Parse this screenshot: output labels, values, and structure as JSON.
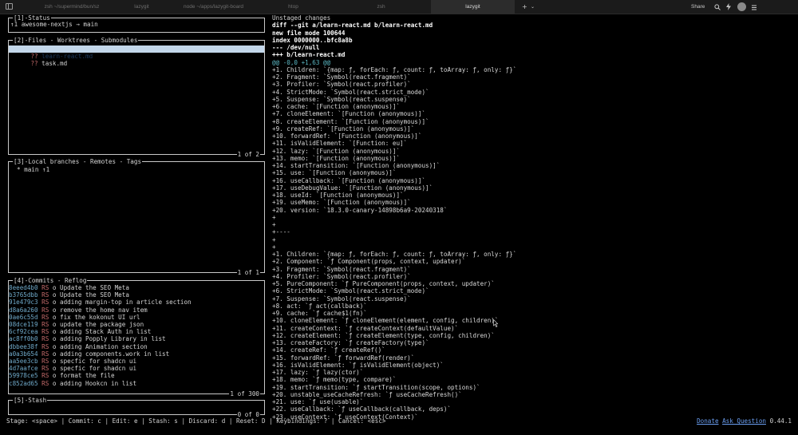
{
  "browser": {
    "tabs": [
      {
        "label": "zsh ~/supermind/bun/sz",
        "active": false
      },
      {
        "label": "lazygit",
        "active": false
      },
      {
        "label": "node ~/apps/lazygit-board",
        "active": false
      },
      {
        "label": "htop",
        "active": false
      },
      {
        "label": "zsh",
        "active": false
      },
      {
        "label": "lazygit",
        "active": true
      }
    ],
    "new_tab": "+",
    "tab_menu": "⌄",
    "share": "Share",
    "icons": [
      "search-icon",
      "bolt-icon",
      "profile-avatar",
      "menu-icon"
    ]
  },
  "status_panel": {
    "title": "[1]-Status",
    "content": "↑1 awesome-nextjs → main"
  },
  "files_panel": {
    "title": "[2]-Files - Worktrees - Submodules",
    "items": [
      {
        "status": "??",
        "name": "learn-react.md",
        "selected": true
      },
      {
        "status": "??",
        "name": "task.md",
        "selected": false
      }
    ],
    "footer": "1 of 2"
  },
  "branches_panel": {
    "title": "[3]-Local branches - Remotes - Tags",
    "items": [
      "* main ↑1"
    ],
    "footer": "1 of 1"
  },
  "commits_panel": {
    "title": "[4]-Commits - Reflog",
    "items": [
      {
        "hash": "8eeed4b0",
        "author": "RS",
        "msg": "Update the SEO Meta"
      },
      {
        "hash": "b3765dbb",
        "author": "RS",
        "msg": "Update the SEO Meta"
      },
      {
        "hash": "91e479c3",
        "author": "RS",
        "msg": "adding margin-top in article section"
      },
      {
        "hash": "d8a6a260",
        "author": "RS",
        "msg": "remove the home nav item"
      },
      {
        "hash": "0ae6c55d",
        "author": "RS",
        "msg": "fix the kokonut UI url"
      },
      {
        "hash": "08dce119",
        "author": "RS",
        "msg": "update the package json"
      },
      {
        "hash": "6cf92cea",
        "author": "RS",
        "msg": "adding Stack Auth in list"
      },
      {
        "hash": "ac8ff0b0",
        "author": "RS",
        "msg": "adding Popply Library in list"
      },
      {
        "hash": "dbbee38f",
        "author": "RS",
        "msg": "adding Animation section"
      },
      {
        "hash": "a0a3b654",
        "author": "RS",
        "msg": "adding components.work in list"
      },
      {
        "hash": "aa5ee3cb",
        "author": "RS",
        "msg": "specfic for shadcn ui"
      },
      {
        "hash": "4d7aafce",
        "author": "RS",
        "msg": "specfic for shadcn ui"
      },
      {
        "hash": "59978ce5",
        "author": "RS",
        "msg": "format the file"
      },
      {
        "hash": "c852ad65",
        "author": "RS",
        "msg": "adding Hookcn in list"
      }
    ],
    "footer": "1 of 300"
  },
  "stash_panel": {
    "title": "[5]-Stash",
    "footer": "0 of 0"
  },
  "diff_panel": {
    "title": "Unstaged changes",
    "header": [
      "diff --git a/learn-react.md b/learn-react.md",
      "new file mode 100644",
      "index 0000000..bfc8a8b",
      "--- /dev/null",
      "+++ b/learn-react.md"
    ],
    "hunk": "@@ -0,0 +1,63 @@",
    "lines": [
      "+1. Children: `{map: ƒ, forEach: ƒ, count: ƒ, toArray: ƒ, only: ƒ}`",
      "+2. Fragment: `Symbol(react.fragment)`",
      "+3. Profiler: `Symbol(react.profiler)`",
      "+4. StrictMode: `Symbol(react.strict_mode)`",
      "+5. Suspense: `Symbol(react.suspense)`",
      "+6. cache: `[Function (anonymous)]`",
      "+7. cloneElement: `[Function (anonymous)]`",
      "+8. createElement: `[Function (anonymous)]`",
      "+9. createRef: `[Function (anonymous)]`",
      "+10. forwardRef: `[Function (anonymous)]`",
      "+11. isValidElement: `[Function: eu]`",
      "+12. lazy: `[Function (anonymous)]`",
      "+13. memo: `[Function (anonymous)]`",
      "+14. startTransition: `[Function (anonymous)]`",
      "+15. use: `[Function (anonymous)]`",
      "+16. useCallback: `[Function (anonymous)]`",
      "+17. useDebugValue: `[Function (anonymous)]`",
      "+18. useId: `[Function (anonymous)]`",
      "+19. useMemo: `[Function (anonymous)]`",
      "+20. version: `18.3.0-canary-14898b6a9-20240318`",
      "+",
      "+",
      "+----",
      "+",
      "+",
      "+1. Children: `{map: ƒ, forEach: ƒ, count: ƒ, toArray: ƒ, only: ƒ}`",
      "+2. Component: `ƒ Component(props, context, updater)`",
      "+3. Fragment: `Symbol(react.fragment)`",
      "+4. Profiler: `Symbol(react.profiler)`",
      "+5. PureComponent: `ƒ PureComponent(props, context, updater)`",
      "+6. StrictMode: `Symbol(react.strict_mode)`",
      "+7. Suspense: `Symbol(react.suspense)`",
      "+8. act: `ƒ act(callback)`",
      "+9. cache: `ƒ cache$1(fn)`",
      "+10. cloneElement: `ƒ cloneElement(element, config, children)`",
      "+11. createContext: `ƒ createContext(defaultValue)`",
      "+12. createElement: `ƒ createElement(type, config, children)`",
      "+13. createFactory: `ƒ createFactory(type)`",
      "+14. createRef: `ƒ createRef()`",
      "+15. forwardRef: `ƒ forwardRef(render)`",
      "+16. isValidElement: `ƒ isValidElement(object)`",
      "+17. lazy: `ƒ lazy(ctor)`",
      "+18. memo: `ƒ memo(type, compare)`",
      "+19. startTransition: `ƒ startTransition(scope, options)`",
      "+20. unstable_useCacheRefresh: `ƒ useCacheRefresh()`",
      "+21. use: `ƒ use(usable)`",
      "+22. useCallback: `ƒ useCallback(callback, deps)`",
      "+23. useContext: `ƒ useContext(Context)`"
    ]
  },
  "status_bar": {
    "left": "Stage: <space> | Commit: c | Edit: e | Stash: s | Discard: d | Reset: D | Keybindings: ? | Cancel: <esc>",
    "donate": "Donate",
    "ask": "Ask Question",
    "version": "0.44.1"
  }
}
